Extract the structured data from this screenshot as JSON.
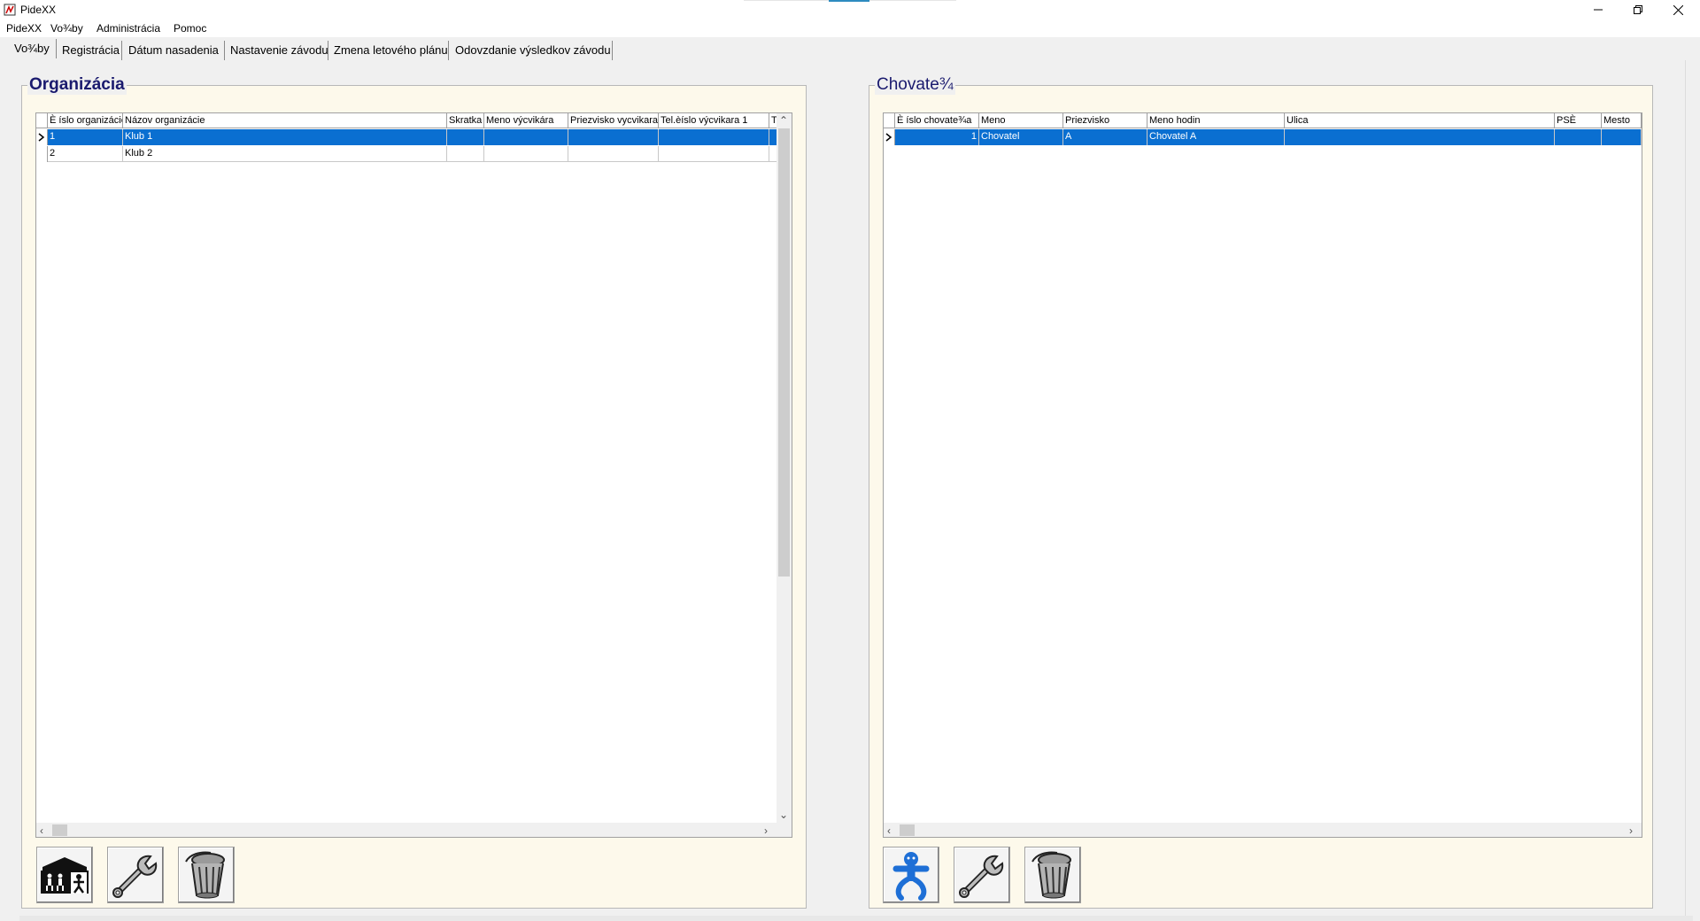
{
  "window": {
    "title": "PideXX",
    "minimize_icon": "minimize-icon",
    "maximize_icon": "restore-icon",
    "close_icon": "close-icon"
  },
  "menu": [
    "PideXX",
    "Vo¾by",
    "Administrácia",
    "Pomoc"
  ],
  "tabs": [
    "Vo¾by",
    "Registrácia",
    "Dátum nasadenia",
    "Nastavenie závodu",
    "Zmena letového plánu",
    "Odovzdanie výsledkov závodu"
  ],
  "active_tab": 0,
  "organization_panel": {
    "title": "Organizácia",
    "columns": [
      "È íslo organizácie",
      "Názov organizácie",
      "Skratka",
      "Meno výcvikára",
      "Priezvisko vycvikara",
      "Tel.èíslo výcvikara 1",
      "T"
    ],
    "rows": [
      [
        "1",
        "Klub 1",
        "",
        "",
        "",
        "",
        ""
      ],
      [
        "2",
        "Klub 2",
        "",
        "",
        "",
        "",
        ""
      ]
    ],
    "selected_row": 0,
    "buttons": [
      {
        "name": "add-organization-button",
        "icon": "organization-icon"
      },
      {
        "name": "edit-organization-button",
        "icon": "wrench-icon"
      },
      {
        "name": "delete-organization-button",
        "icon": "trash-icon"
      }
    ]
  },
  "breeder_panel": {
    "title": "Chovate¾",
    "columns": [
      "È íslo chovate¾a",
      "Meno",
      "Priezvisko",
      "Meno hodin",
      "Ulica",
      "PSÈ",
      "Mesto"
    ],
    "rows": [
      [
        "1",
        "Chovatel",
        "A",
        "Chovatel A",
        "",
        "",
        ""
      ]
    ],
    "selected_row": 0,
    "buttons": [
      {
        "name": "add-breeder-button",
        "icon": "person-icon"
      },
      {
        "name": "edit-breeder-button",
        "icon": "wrench-icon"
      },
      {
        "name": "delete-breeder-button",
        "icon": "trash-icon"
      }
    ]
  },
  "colors": {
    "selection": "#0a6fd1",
    "panel_bg": "#fdf9eb",
    "legend_text": "#1a1a6e"
  }
}
